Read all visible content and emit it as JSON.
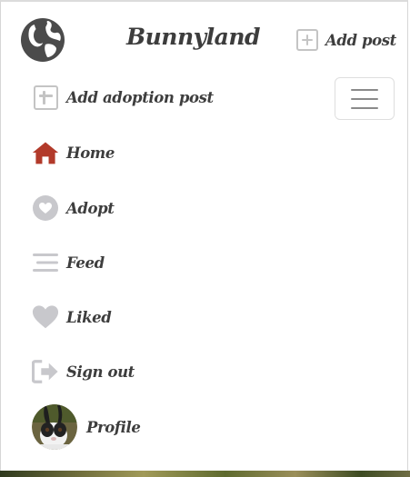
{
  "header": {
    "brand": "Bunnyland",
    "add_post_label": "Add post",
    "logo_icon": "bunny-globe-logo"
  },
  "menu": {
    "items": [
      {
        "label": "Add adoption post",
        "icon": "plus-square-icon"
      },
      {
        "label": "Home",
        "icon": "home-icon",
        "icon_color": "#b23a2a"
      },
      {
        "label": "Adopt",
        "icon": "heart-circle-icon"
      },
      {
        "label": "Feed",
        "icon": "lines-icon"
      },
      {
        "label": "Liked",
        "icon": "heart-icon"
      },
      {
        "label": "Sign out",
        "icon": "sign-out-icon"
      },
      {
        "label": "Profile",
        "icon": "avatar"
      }
    ]
  },
  "colors": {
    "icon_gray": "#c8c8cc",
    "text": "#3d3d3d",
    "home_icon": "#b23a2a"
  }
}
